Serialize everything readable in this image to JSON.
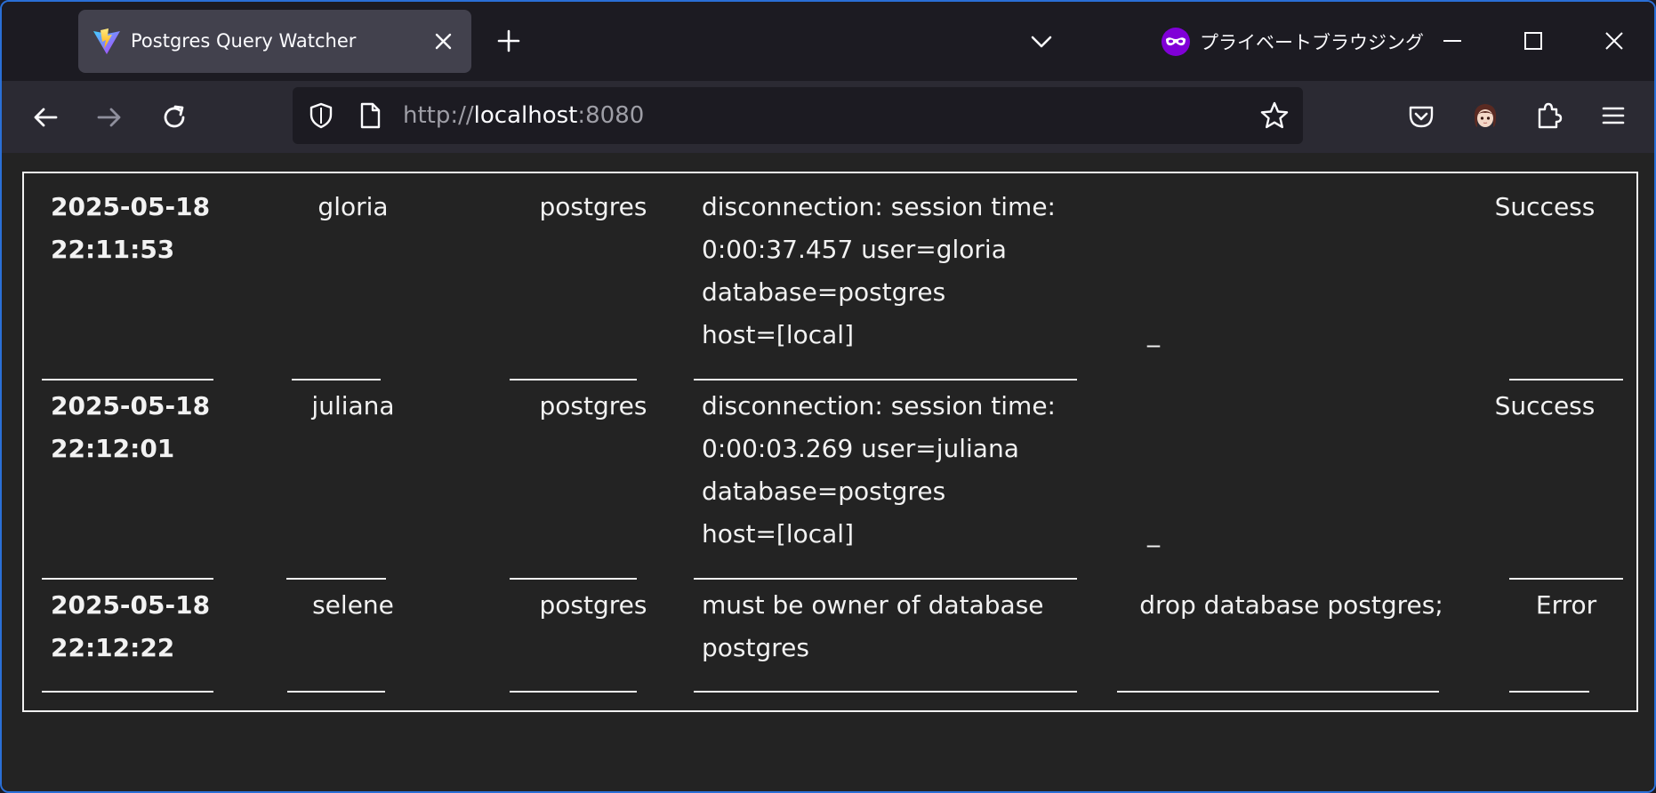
{
  "browser": {
    "tab_title": "Postgres Query Watcher",
    "private_label": "プライベートブラウジング",
    "url_scheme": "http://",
    "url_host": "localhost",
    "url_port": ":8080"
  },
  "rows": [
    {
      "timestamp_date": "2025-05-18",
      "timestamp_time": "22:11:53",
      "user": "gloria",
      "database": "postgres",
      "message_lines": [
        "disconnection: session time:",
        "0:00:37.457 user=gloria",
        "database=postgres",
        "host=[local]"
      ],
      "query": "_",
      "status": "Success"
    },
    {
      "timestamp_date": "2025-05-18",
      "timestamp_time": "22:12:01",
      "user": "juliana",
      "database": "postgres",
      "message_lines": [
        "disconnection: session time:",
        "0:00:03.269 user=juliana",
        "database=postgres",
        "host=[local]"
      ],
      "query": "_",
      "status": "Success"
    },
    {
      "timestamp_date": "2025-05-18",
      "timestamp_time": "22:12:22",
      "user": "selene",
      "database": "postgres",
      "message_lines": [
        "must be owner of database",
        "postgres"
      ],
      "query": "drop database postgres;",
      "status": "Error"
    }
  ],
  "colors": {
    "accent_border": "#2a6fd6",
    "private_icon": "#8000d7",
    "content_bg": "#232323"
  }
}
